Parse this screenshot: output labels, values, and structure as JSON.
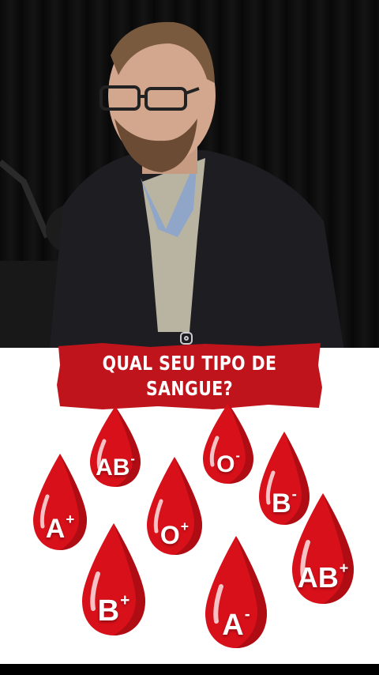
{
  "banner": {
    "line1": "QUAL SEU TIPO DE",
    "line2": "SANGUE?"
  },
  "drops": [
    {
      "type": "AB",
      "sign": "-"
    },
    {
      "type": "O",
      "sign": "-"
    },
    {
      "type": "A",
      "sign": "+"
    },
    {
      "type": "O",
      "sign": "+"
    },
    {
      "type": "B",
      "sign": "-"
    },
    {
      "type": "AB",
      "sign": "+"
    },
    {
      "type": "B",
      "sign": "+"
    },
    {
      "type": "A",
      "sign": "-"
    }
  ],
  "colors": {
    "banner_red": "#c0141c",
    "drop_red": "#d8101a",
    "drop_dark": "#8e0a10"
  },
  "icons": {
    "watermark": "instagram-icon"
  }
}
